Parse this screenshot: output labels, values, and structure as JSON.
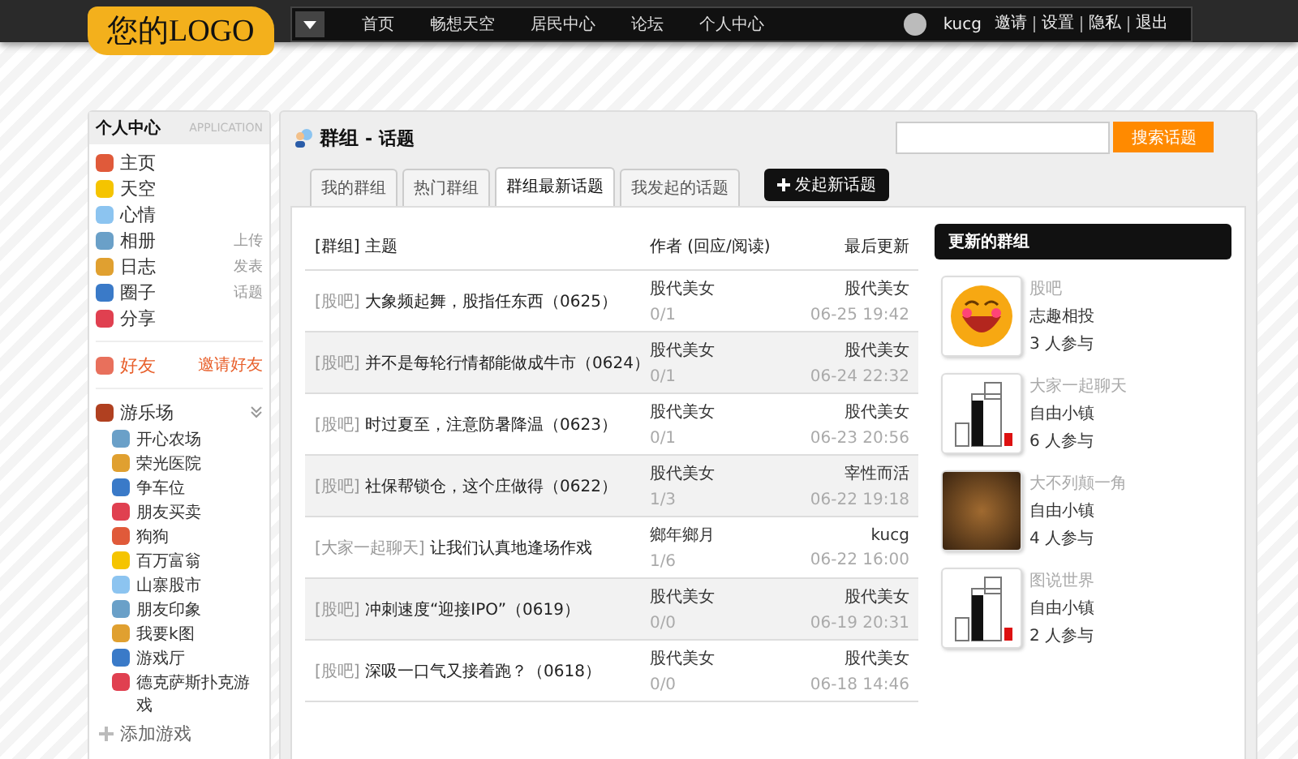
{
  "logo": "您的LOGO",
  "nav": {
    "links": [
      "首页",
      "畅想天空",
      "居民中心",
      "论坛",
      "个人中心"
    ],
    "user": "kucg",
    "user_links": [
      "邀请",
      "设置",
      "隐私",
      "退出"
    ]
  },
  "sidebar": {
    "title": "个人中心",
    "subtitle": "APPLICATION",
    "items": [
      {
        "label": "主页"
      },
      {
        "label": "天空"
      },
      {
        "label": "心情"
      },
      {
        "label": "相册",
        "action": "上传"
      },
      {
        "label": "日志",
        "action": "发表"
      },
      {
        "label": "圈子",
        "action": "话题"
      },
      {
        "label": "分享"
      }
    ],
    "friends": {
      "label": "好友",
      "action": "邀请好友"
    },
    "games_title": "游乐场",
    "games": [
      "开心农场",
      "荣光医院",
      "争车位",
      "朋友买卖",
      "狗狗",
      "百万富翁",
      "山寨股市",
      "朋友印象",
      "我要k图",
      "游戏厅",
      "德克萨斯扑克游戏"
    ],
    "add_game": "添加游戏"
  },
  "page_title": "群组",
  "page_subtitle": "- 话题",
  "search": {
    "button": "搜索话题"
  },
  "tabs": [
    {
      "label": "我的群组",
      "selected": false
    },
    {
      "label": "热门群组",
      "selected": false
    },
    {
      "label": "群组最新话题",
      "selected": true
    },
    {
      "label": "我发起的话题",
      "selected": false
    }
  ],
  "new_topic_button": "发起新话题",
  "table": {
    "columns": [
      "[群组] 主题",
      "作者 (回应/阅读)",
      "最后更新"
    ],
    "rows": [
      {
        "group": "[股吧]",
        "title": "大象频起舞，股指任东西（0625）",
        "author": "股代美女",
        "counts": "0/1",
        "last_author": "股代美女",
        "time": "06-25 19:42"
      },
      {
        "group": "[股吧]",
        "title": "并不是每轮行情都能做成牛市（0624）",
        "author": "股代美女",
        "counts": "0/1",
        "last_author": "股代美女",
        "time": "06-24 22:32"
      },
      {
        "group": "[股吧]",
        "title": "时过夏至，注意防暑降温（0623）",
        "author": "股代美女",
        "counts": "0/1",
        "last_author": "股代美女",
        "time": "06-23 20:56"
      },
      {
        "group": "[股吧]",
        "title": "社保帮锁仓，这个庄做得（0622）",
        "author": "股代美女",
        "counts": "1/3",
        "last_author": "宰性而活",
        "time": "06-22 19:18"
      },
      {
        "group": "[大家一起聊天]",
        "title": "让我们认真地逢场作戏",
        "author": "鄉年鄉月",
        "counts": "1/6",
        "last_author": "kucg",
        "time": "06-22 16:00"
      },
      {
        "group": "[股吧]",
        "title": "冲刺速度“迎接IPO”（0619）",
        "author": "股代美女",
        "counts": "0/0",
        "last_author": "股代美女",
        "time": "06-19 20:31"
      },
      {
        "group": "[股吧]",
        "title": "深吸一口气又接着跑？（0618）",
        "author": "股代美女",
        "counts": "0/0",
        "last_author": "股代美女",
        "time": "06-18 14:46"
      }
    ]
  },
  "updated_groups": {
    "title": "更新的群组",
    "items": [
      {
        "kind": "smiley",
        "name": "股吧",
        "category": "志趣相投",
        "members": "3 人参与"
      },
      {
        "kind": "logo",
        "name": "大家一起聊天",
        "category": "自由小镇",
        "members": "6 人参与"
      },
      {
        "kind": "photo",
        "name": "大不列颠一角",
        "category": "自由小镇",
        "members": "4 人参与"
      },
      {
        "kind": "logo",
        "name": "图说世界",
        "category": "自由小镇",
        "members": "2 人参与"
      }
    ]
  }
}
